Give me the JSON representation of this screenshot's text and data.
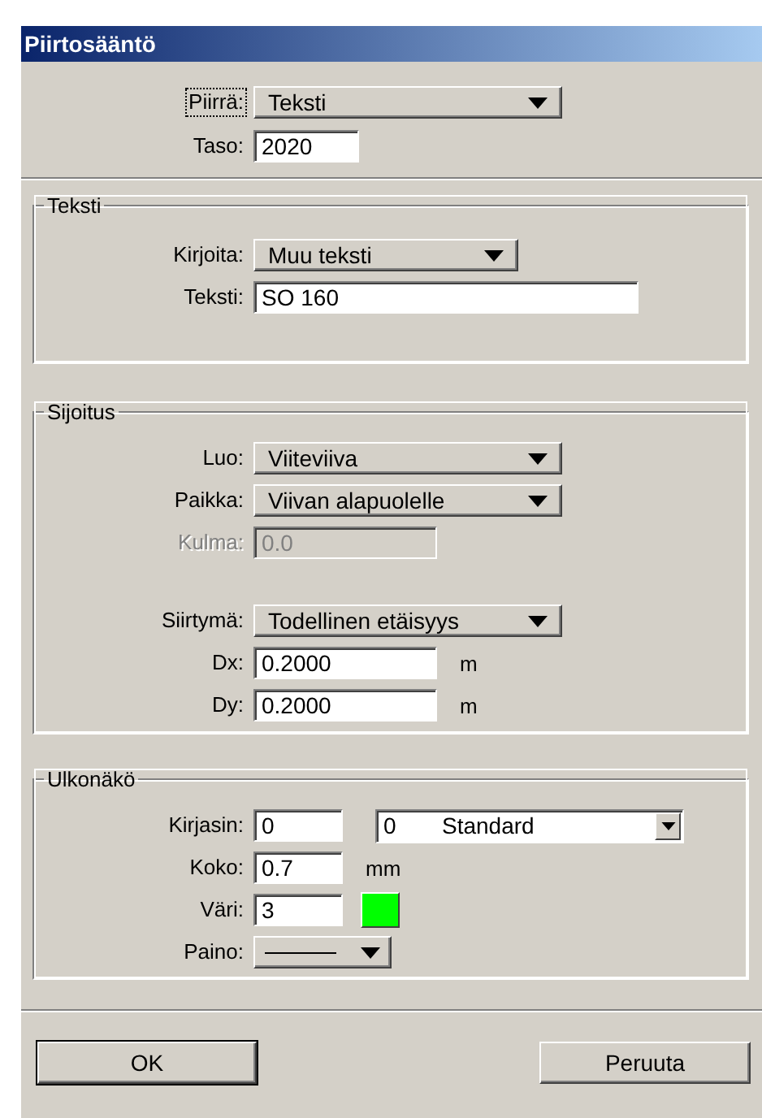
{
  "window": {
    "title": "Piirtosääntö"
  },
  "top_fields": [
    {
      "kind": "dropdown",
      "label": "Piirrä:",
      "value": "Teksti",
      "focused": true
    },
    {
      "kind": "input",
      "label": "Taso:",
      "value": "2020",
      "focused": false
    }
  ],
  "groups": [
    {
      "title": "Teksti",
      "fields": [
        {
          "kind": "dropdown",
          "label": "Kirjoita:",
          "value": "Muu teksti"
        },
        {
          "kind": "input",
          "label": "Teksti:",
          "value": "SO 160",
          "disabled": false
        }
      ]
    },
    {
      "title": "Sijoitus",
      "fields": [
        {
          "kind": "dropdown",
          "label": "Luo:",
          "value": "Viiteviiva"
        },
        {
          "kind": "dropdown",
          "label": "Paikka:",
          "value": "Viivan alapuolelle"
        },
        {
          "kind": "input",
          "label": "Kulma:",
          "value": "0.0",
          "disabled": true
        },
        {
          "kind": "dropdown",
          "label": "Siirtymä:",
          "value": "Todellinen etäisyys"
        },
        {
          "kind": "input",
          "label": "Dx:",
          "value": "0.2000",
          "unit": "m",
          "disabled": false
        },
        {
          "kind": "input",
          "label": "Dy:",
          "value": "0.2000",
          "unit": "m",
          "disabled": false
        }
      ]
    },
    {
      "title": "Ulkonäkö",
      "fields": [
        {
          "kind": "font",
          "label": "Kirjasin:",
          "value": "0",
          "combo_code": "0",
          "combo_name": "Standard"
        },
        {
          "kind": "input",
          "label": "Koko:",
          "value": "0.7",
          "unit": "mm",
          "disabled": false
        },
        {
          "kind": "color",
          "label": "Väri:",
          "value": "3",
          "color": "#00ff00"
        },
        {
          "kind": "line",
          "label": "Paino:"
        }
      ]
    }
  ],
  "buttons": [
    {
      "label": "OK",
      "default": true
    },
    {
      "label": "Peruuta",
      "default": false
    }
  ]
}
